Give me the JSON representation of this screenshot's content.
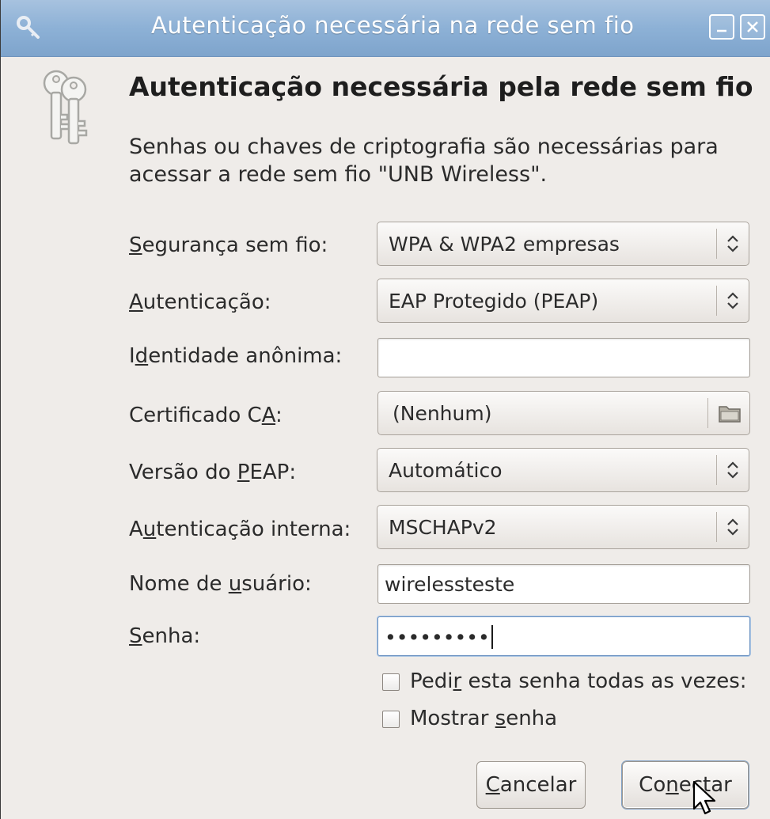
{
  "window": {
    "title": "Autenticação necessária na rede sem fio",
    "icons": {
      "title_icon": "key-icon",
      "minimize": "minimize-icon",
      "close": "close-icon"
    }
  },
  "dialog": {
    "icon": "keys-icon",
    "heading": "Autenticação necessária pela rede sem fio",
    "description": "Senhas ou chaves de criptografia são necessárias para acessar a rede sem fio \"UNB Wireless\"."
  },
  "form": {
    "security": {
      "label_pre": "",
      "label_key": "S",
      "label_post": "egurança sem fio:",
      "value": "WPA & WPA2 empresas"
    },
    "authentication": {
      "label_pre": "",
      "label_key": "A",
      "label_post": "utenticação:",
      "value": "EAP Protegido (PEAP)"
    },
    "anonymous_identity": {
      "label_pre": "I",
      "label_key": "d",
      "label_post": "entidade anônima:",
      "value": ""
    },
    "ca_certificate": {
      "label_pre": "Certificado C",
      "label_key": "A",
      "label_post": ":",
      "value": "(Nenhum)"
    },
    "peap_version": {
      "label_pre": "Versão do ",
      "label_key": "P",
      "label_post": "EAP:",
      "value": "Automático"
    },
    "inner_auth": {
      "label_pre": "A",
      "label_key": "u",
      "label_post": "tenticação interna:",
      "value": "MSCHAPv2"
    },
    "username": {
      "label_pre": "Nome de ",
      "label_key": "u",
      "label_post": "suário:",
      "value": "wirelessteste"
    },
    "password": {
      "label_pre": "",
      "label_key": "S",
      "label_post": "enha:",
      "value": "•••••••••"
    },
    "ask_every_time": {
      "label_pre": "Pedi",
      "label_key": "r",
      "label_post": " esta senha todas as vezes:",
      "checked": false
    },
    "show_password": {
      "label_pre": "Mostrar ",
      "label_key": "s",
      "label_post": "enha",
      "checked": false
    }
  },
  "buttons": {
    "cancel": {
      "label_pre": "",
      "label_key": "C",
      "label_post": "ancelar"
    },
    "connect": {
      "label_pre": "Co",
      "label_key": "n",
      "label_post": "ectar"
    }
  },
  "colors": {
    "titlebar": "#8db1d6",
    "window_bg": "#efece9",
    "focus": "#6c93c2"
  }
}
